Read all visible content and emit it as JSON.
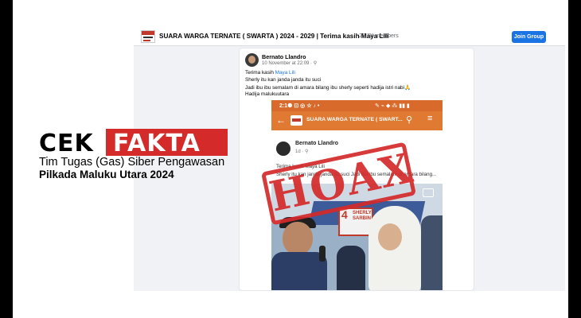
{
  "group_header": {
    "title": "SUARA WARGA TERNATE ( SWARTA ) 2024 - 2029 | Terima kasih Maya Lili",
    "separator": "·",
    "members": "28.7K members",
    "join_label": "Join Group"
  },
  "post": {
    "author": "Bernato Llandro",
    "timestamp": "10 November at 22:09 · ⚲",
    "line1_prefix": "Terima kasih ",
    "line1_mention": "Maya Lili",
    "line2": "Sherly itu kan janda janda itu suci",
    "line3": "Jadi ibu ibu semalam di amara bilang ibu sherly seperti hadija istri nabi🙏",
    "line4": "Hadija malukuutara"
  },
  "embedded_screenshot": {
    "status_time": "2:1⚈ ⊡ ◎ ☆ ♪ •",
    "status_icons": "✎ ⌁ ◆ ⁂ ▮▮ ▮",
    "app_title": "SUARA WARGA TERNATE ( SWART...",
    "inner_author": "Bernato Llandro",
    "inner_time": "1d · ⚲",
    "inner_text": "Terima kasih Maya Lili",
    "inner_text2": "Sherly itu kan janda janda itu suci Jadi ibu ibu semalam di amara bilang...",
    "banner_number": "4",
    "banner_text": "SHERLY\nSARBIN"
  },
  "stamp": {
    "text": "HOAX",
    "color": "#d42a2a"
  },
  "branding": {
    "cek": "CEK",
    "fakta": "FAKTA",
    "tagline1": "Tim Tugas (Gas) Siber Pengawasan",
    "tagline2": "Pilkada Maluku Utara 2024",
    "accent": "#d42a2a"
  },
  "colors": {
    "facebook_blue": "#1b74e4",
    "app_orange": "#e07932"
  }
}
